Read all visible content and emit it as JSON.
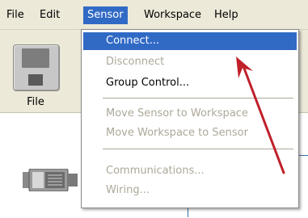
{
  "menubar": {
    "items": [
      "File",
      "Edit",
      "Sensor",
      "Workspace",
      "Help"
    ],
    "active": "Sensor"
  },
  "toolbar": {
    "file_button_label": "File"
  },
  "sensor_menu": {
    "items": [
      {
        "label": "Connect...",
        "state": "highlighted"
      },
      {
        "label": "Disconnect",
        "state": "disabled"
      },
      {
        "label": "Group Control...",
        "state": "enabled"
      },
      {
        "label": "Move Sensor to Workspace",
        "state": "disabled"
      },
      {
        "label": "Move Workspace to Sensor",
        "state": "disabled"
      },
      {
        "label": "Communications...",
        "state": "disabled"
      },
      {
        "label": "Wiring...",
        "state": "disabled"
      }
    ]
  },
  "colors": {
    "menu_highlight": "#316ac5",
    "disabled_text": "#aca899",
    "arrow": "#c0202a"
  },
  "icons": [
    "floppy-disk-icon",
    "sensor-device-icon",
    "red-arrow-annotation"
  ]
}
